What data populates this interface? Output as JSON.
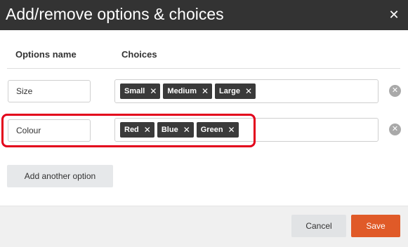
{
  "dialog": {
    "title": "Add/remove options & choices",
    "close_icon": "close-icon"
  },
  "columns": {
    "options_name": "Options name",
    "choices": "Choices"
  },
  "rows": [
    {
      "option_name": "Size",
      "choices": [
        "Small",
        "Medium",
        "Large"
      ]
    },
    {
      "option_name": "Colour",
      "choices": [
        "Red",
        "Blue",
        "Green"
      ]
    }
  ],
  "add_option_label": "Add another option",
  "footer": {
    "cancel_label": "Cancel",
    "save_label": "Save"
  },
  "colors": {
    "header_bg": "#333333",
    "tag_bg": "#3a3a3a",
    "highlight": "#e3001b",
    "save_bg": "#e05a28",
    "footer_bg": "#f0f0f0"
  },
  "highlighted_row": 1
}
